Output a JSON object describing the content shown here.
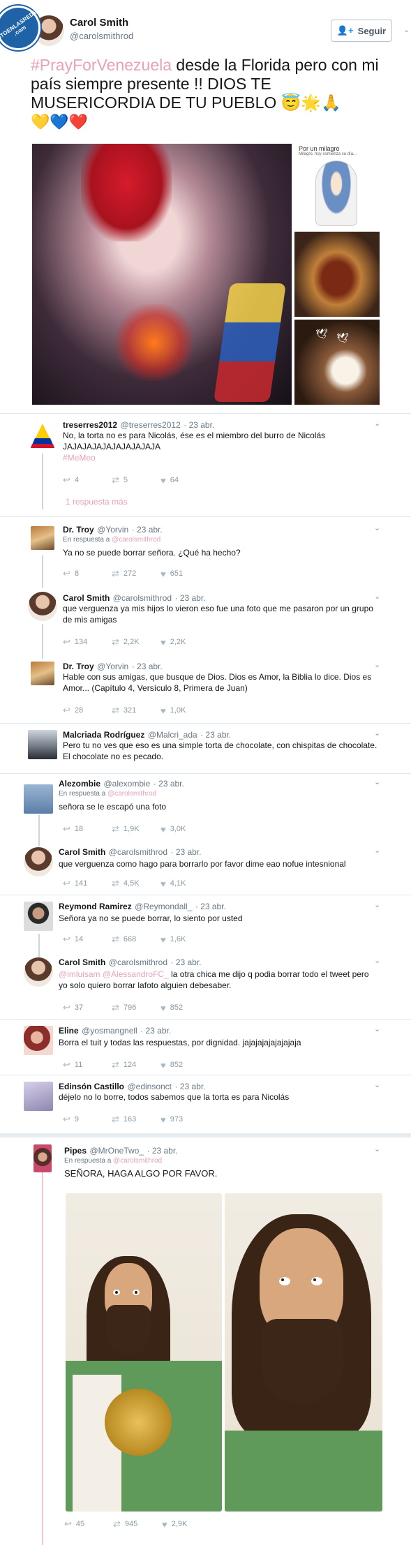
{
  "watermark": {
    "text": "VISTOENLASREDES .com"
  },
  "tweet": {
    "author_name": "Carol Smith",
    "author_handle": "@carolsmithrod",
    "follow_label": "Seguir",
    "hashtag": "#PrayForVenezuela",
    "text": " desde la Florida pero con mi país siempre presente !! DIOS TE MUSERICORDIA DE TU PUEBLO 😇🌟🙏",
    "text_line2": "💛💙❤️",
    "media": {
      "side_caption": "Por un milagro",
      "side_caption_small": "Milagro, hoy comienza su día..."
    }
  },
  "replies": [
    {
      "name": "treserres2012",
      "handle": "@treserres2012",
      "date": "23 abr.",
      "in_reply": "",
      "text": "No, la torta no es para Nicolás, ése es el miembro del burro de Nicolás JAJAJAJAJAJAJAJAJAJA",
      "hashtag": "#MeMeo",
      "replies": "4",
      "retweets": "5",
      "likes": "64",
      "more": "1 respuesta más"
    },
    {
      "name": "Dr. Troy",
      "handle": "@Yorvin",
      "date": "23 abr.",
      "in_reply_prefix": "En respuesta a",
      "in_reply_to": "@carolsmithrod",
      "text": "Ya no se puede borrar señora. ¿Qué ha hecho?",
      "replies": "8",
      "retweets": "272",
      "likes": "651"
    },
    {
      "name": "Carol Smith",
      "handle": "@carolsmithrod",
      "date": "23 abr.",
      "text": "que verguenza ya mis hijos lo vieron eso fue una foto que me pasaron por un grupo de mis amigas",
      "replies": "134",
      "retweets": "2,2K",
      "likes": "2,2K"
    },
    {
      "name": "Dr. Troy",
      "handle": "@Yorvin",
      "date": "23 abr.",
      "text": "Hable con sus amigas, que busque de Dios. Dios es Amor, la Biblia lo dice. Dios es Amor... (Capítulo 4, Versículo 8, Primera de Juan)",
      "replies": "28",
      "retweets": "321",
      "likes": "1,0K"
    },
    {
      "name": "Malcriada Rodríguez",
      "handle": "@Malcri_ada",
      "date": "23 abr.",
      "text": "Pero tu no ves que eso es una simple torta de chocolate, con chispitas de chocolate. El chocolate no es pecado."
    },
    {
      "name": "Alezombie",
      "handle": "@alexombie",
      "date": "23 abr.",
      "in_reply_prefix": "En respuesta a",
      "in_reply_to": "@carolsmithrod",
      "text": "señora se le escapó una foto",
      "replies": "18",
      "retweets": "1,9K",
      "likes": "3,0K"
    },
    {
      "name": "Carol Smith",
      "handle": "@carolsmithrod",
      "date": "23 abr.",
      "text": "que verguenza como hago para borrarlo por favor dime eao nofue intesnional",
      "replies": "141",
      "retweets": "4,5K",
      "likes": "4,1K"
    },
    {
      "name": "Reymond Ramirez",
      "handle": "@Reymondall_",
      "date": "23 abr.",
      "text": "Señora ya no se puede borrar, lo siento por usted",
      "replies": "14",
      "retweets": "668",
      "likes": "1,6K"
    },
    {
      "name": "Carol Smith",
      "handle": "@carolsmithrod",
      "date": "23 abr.",
      "mention1": "@imluisam",
      "mention2": "@AlessandroFC_",
      "text": " la otra chica me dijo q podia borrar todo el tweet pero yo solo quiero borrar lafoto alguien debesaber.",
      "replies": "37",
      "retweets": "796",
      "likes": "852"
    },
    {
      "name": "Eline",
      "handle": "@yosmangnell",
      "date": "23 abr.",
      "text": "Borra el tuit y todas las respuestas, por dignidad. jajajajajajajajaja",
      "replies": "11",
      "retweets": "124",
      "likes": "852"
    },
    {
      "name": "Edinsón Castillo",
      "handle": "@edinsonct",
      "date": "23 abr.",
      "text": "déjelo no lo borre, todos sabemos que la torta es para Nicolás",
      "replies": "9",
      "retweets": "163",
      "likes": "973"
    },
    {
      "name": "Pipes",
      "handle": "@MrOneTwo_",
      "date": "23 abr.",
      "in_reply_prefix": "En respuesta a",
      "in_reply_to": "@carolsmithrod",
      "text": "SEÑORA, HAGA ALGO POR FAVOR.",
      "replies": "45",
      "retweets": "945",
      "likes": "2,9K"
    }
  ],
  "icons": {
    "reply": "reply-icon",
    "retweet": "retweet-icon",
    "like": "heart-icon",
    "follow": "add-user-icon",
    "more": "chevron-down-icon"
  },
  "colors": {
    "hashtag": "#e8a2b8",
    "follow_icon": "#1da1f2",
    "muted": "#657786"
  }
}
